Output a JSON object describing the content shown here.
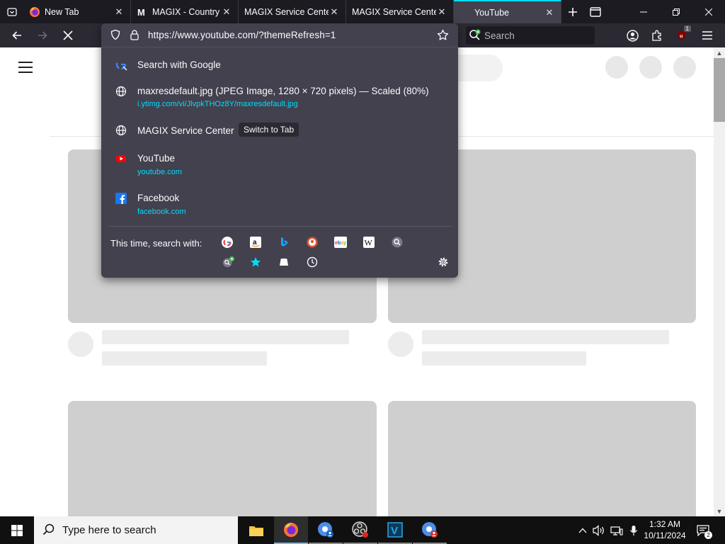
{
  "tabs": [
    {
      "title": "New Tab",
      "favicon": "firefox-icon",
      "active": false
    },
    {
      "title": "MAGIX - Country",
      "favicon": "magix-m-icon",
      "active": false
    },
    {
      "title": "MAGIX Service Center",
      "favicon": "",
      "active": false
    },
    {
      "title": "MAGIX Service Center",
      "favicon": "",
      "active": false
    },
    {
      "title": "YouTube",
      "favicon": "",
      "active": true
    }
  ],
  "toolbar": {
    "search_placeholder": "Search",
    "extension_badge": "1"
  },
  "urlbar": {
    "url": "https://www.youtube.com/?themeRefresh=1"
  },
  "suggestions": {
    "search_google": "Search with Google",
    "image_title": "maxresdefault.jpg (JPEG Image, 1280 × 720 pixels) — Scaled (80%)",
    "image_url": "i.ytimg.com/vi/JlvpkTHOz8Y/maxresdefault.jpg",
    "magix_title": "MAGIX Service Center",
    "switch_to_tab": "Switch to Tab",
    "youtube_title": "YouTube",
    "youtube_url": "youtube.com",
    "facebook_title": "Facebook",
    "facebook_url": "facebook.com"
  },
  "one_off": {
    "label": "This time, search with:",
    "engines": [
      "google",
      "amazon",
      "bing",
      "duckduckgo",
      "ebay",
      "wikipedia",
      "search-engine",
      "add-search-engine",
      "bookmarks",
      "tabs",
      "history"
    ]
  },
  "taskbar": {
    "search_placeholder": "Type here to search",
    "time": "1:32 AM",
    "date": "10/11/2024"
  },
  "colors": {
    "accent": "#00ddff",
    "panel": "#42414d",
    "tabstrip": "#1c1b22",
    "navbar": "#2b2a33"
  }
}
